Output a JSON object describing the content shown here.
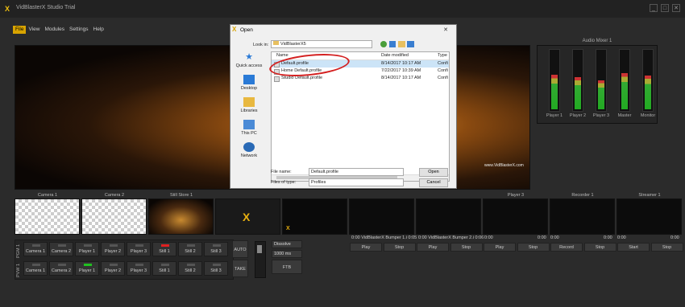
{
  "app": {
    "title": "VidBlasterX Studio Trial",
    "logo": "X",
    "window_buttons": [
      "_",
      "□",
      "✕"
    ]
  },
  "menu": [
    "File",
    "View",
    "Modules",
    "Settings",
    "Help"
  ],
  "monitor": {
    "title": "Monitor 1: PVW 1",
    "watermark": "www.VidBlasterX.com"
  },
  "audio_mixer": {
    "title": "Audio Mixer 1",
    "channels": [
      {
        "label": "Player 1",
        "level": 0.6
      },
      {
        "label": "Player 2",
        "level": 0.55
      },
      {
        "label": "Player 3",
        "level": 0.5
      },
      {
        "label": "Master",
        "level": 0.62
      },
      {
        "label": "Monitor",
        "level": 0.58
      }
    ],
    "scale": [
      "+10",
      "+5",
      "0",
      "-5",
      "-10",
      "-15",
      "-20",
      "-30",
      "-40",
      "-60"
    ]
  },
  "sources": [
    {
      "label": "Camera 1",
      "kind": "checker"
    },
    {
      "label": "Camera 2",
      "kind": "checker"
    },
    {
      "label": "Still Store 1",
      "kind": "still"
    },
    {
      "label": "",
      "kind": "logo"
    },
    {
      "label": "",
      "kind": "bumper"
    },
    {
      "label": "",
      "kind": "dark"
    },
    {
      "label": "",
      "kind": "dark"
    },
    {
      "label": "Player 3",
      "kind": "dark"
    },
    {
      "label": "Recorder 1",
      "kind": "dark"
    },
    {
      "label": "Streamer 1",
      "kind": "dark"
    }
  ],
  "players": {
    "p1_status": "0:00 VidBlasterX Bumper 1.i 0:05",
    "p2_status": "0:00 VidBlasterX Bumper 2.i 0:06",
    "p3_left": "0:00",
    "p3_right": "0:00",
    "rec_left": "0:00",
    "rec_right": "0:00",
    "str_left": "0:00",
    "str_right": "0:00",
    "buttons": [
      "Play",
      "Stop",
      "Play",
      "Stop",
      "Play",
      "Stop",
      "Record",
      "Stop",
      "Start",
      "Stop"
    ]
  },
  "switcher": {
    "pgm_label": "PGM 1",
    "pvw_label": "PVW 1",
    "pgm_buttons": [
      "Camera 1",
      "Camera 2",
      "Player 1",
      "Player 2",
      "Player 3",
      "Still 1",
      "Still 2",
      "Still 3"
    ],
    "pvw_buttons": [
      "Camera 1",
      "Camera 2",
      "Player 1",
      "Player 2",
      "Player 3",
      "Still 1",
      "Still 2",
      "Still 3"
    ],
    "auto": "AUTO",
    "take": "TAKE",
    "transition": "Dissolve",
    "duration": "1000 ms",
    "ftb": "FTB"
  },
  "dialog": {
    "title": "Open",
    "close": "✕",
    "look_in_label": "Look in:",
    "look_in_value": "VidBlasterX5",
    "places": [
      "Quick access",
      "Desktop",
      "Libraries",
      "This PC",
      "Network"
    ],
    "columns": [
      "Name",
      "Date modified",
      "Type"
    ],
    "files": [
      {
        "name": "Default.profile",
        "date": "8/14/2017 10:17 AM",
        "type": "Confi",
        "selected": true
      },
      {
        "name": "Home Default.profile",
        "date": "7/22/2017 10:39 AM",
        "type": "Confi",
        "selected": false
      },
      {
        "name": "Studio Default.profile",
        "date": "8/14/2017 10:17 AM",
        "type": "Confi",
        "selected": false
      }
    ],
    "file_name_label": "File name:",
    "file_name_value": "Default.profile",
    "file_type_label": "Files of type:",
    "file_type_value": "Profiles",
    "open_button": "Open",
    "cancel_button": "Cancel",
    "highlight_color": "#d42020"
  }
}
